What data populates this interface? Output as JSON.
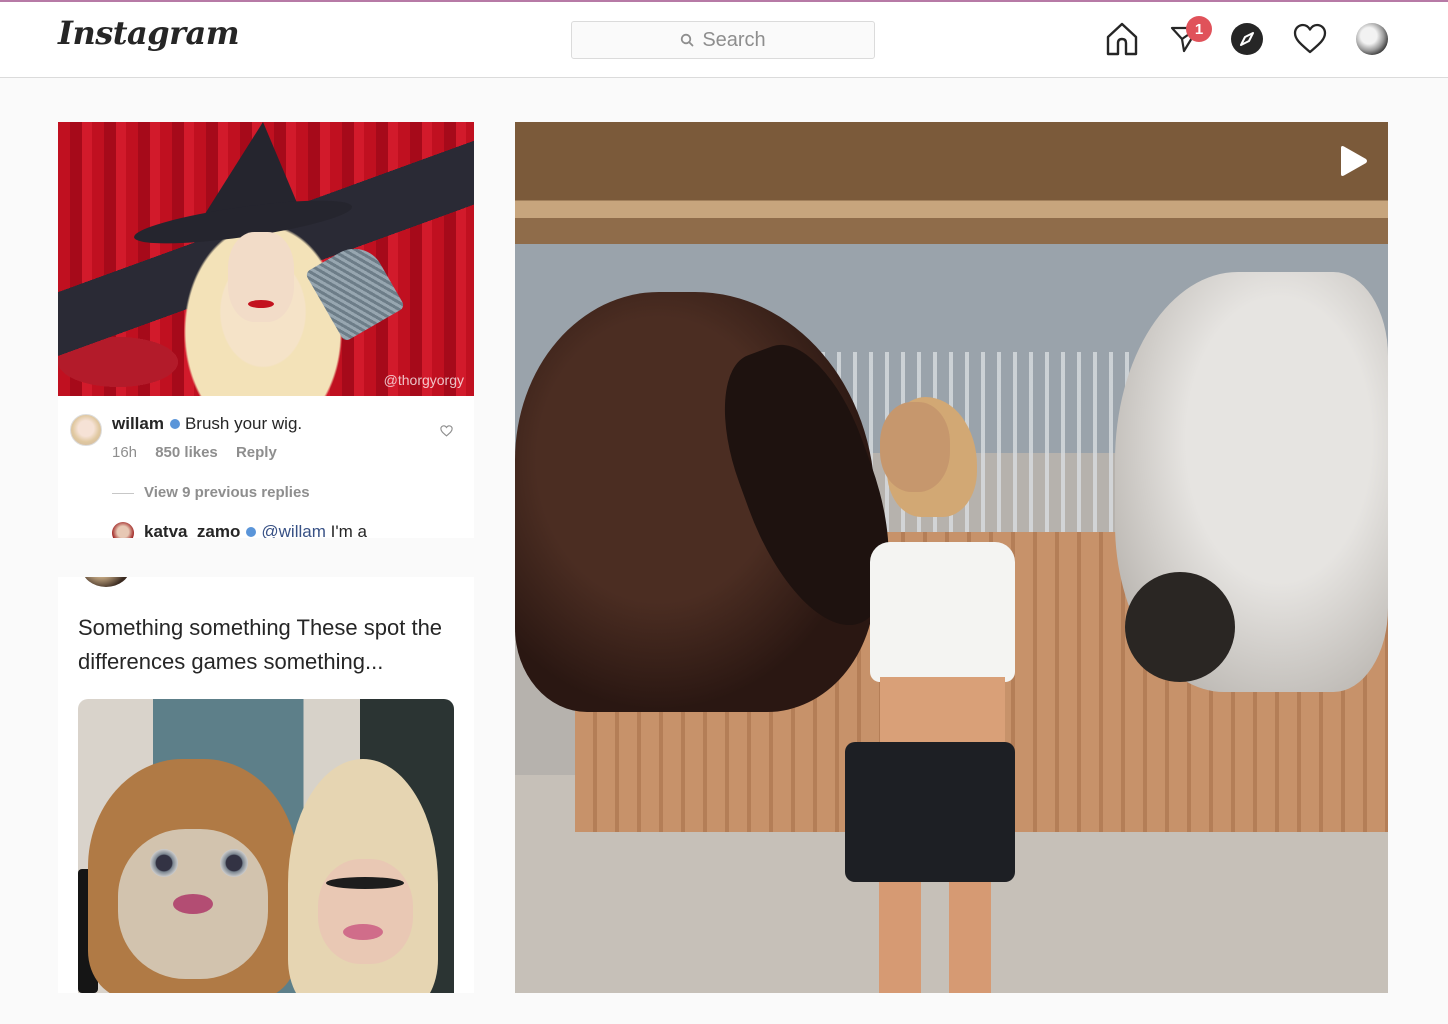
{
  "app": {
    "name": "Instagram",
    "accent_color": "#b77aa6"
  },
  "navbar": {
    "logo_text": "Instagram",
    "search": {
      "placeholder": "Search",
      "value": ""
    },
    "icons": [
      {
        "name": "home-icon",
        "label": "Home"
      },
      {
        "name": "direct-icon",
        "label": "Direct",
        "badge": "1"
      },
      {
        "name": "explore-icon",
        "label": "Explore"
      },
      {
        "name": "activity-icon",
        "label": "Activity"
      },
      {
        "name": "profile-avatar",
        "label": "Profile"
      }
    ],
    "badge_color": "#e0525a"
  },
  "posts": [
    {
      "type": "image",
      "image_description": "Witch in black hat with blonde wig holding a broom, red curtains",
      "watermark": "@thorgyorgy",
      "comments": [
        {
          "user": "willam",
          "verified": true,
          "text": "Brush your wig.",
          "time": "16h",
          "likes": "850 likes",
          "reply_label": "Reply"
        }
      ],
      "view_replies": "View 9 previous replies",
      "reply": {
        "user": "katva_zamo",
        "verified": true,
        "mention": "@willam",
        "text": "I'm a"
      }
    },
    {
      "type": "text-image",
      "text": "Something something These spot the differences games something...",
      "image_description": "Doll and drag queen side by side selfie"
    },
    {
      "type": "video",
      "image_description": "Woman standing between two horses in a barn",
      "play_icon": "play-icon"
    }
  ]
}
